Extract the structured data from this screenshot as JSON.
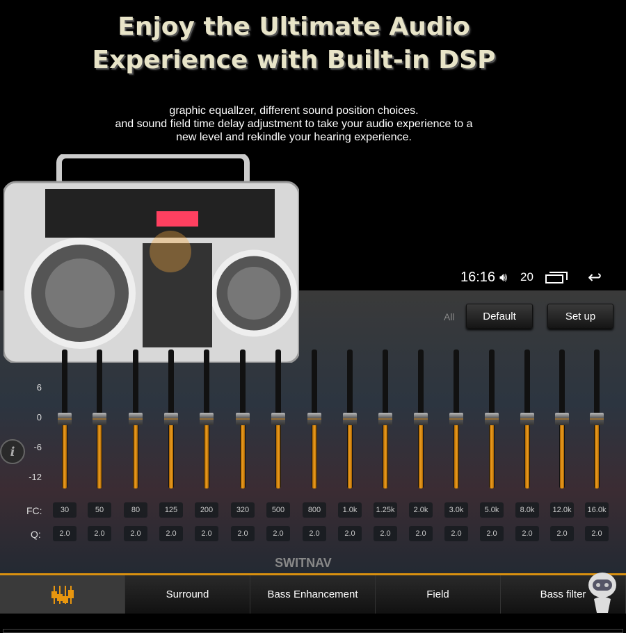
{
  "headline": [
    "Enjoy the Ultimate Audio",
    "Experience with Built-in DSP"
  ],
  "subtitle": [
    "graphic equallzer, different sound position choices.",
    "and sound field time delay adjustment to take your audio experience to a",
    "new level and rekindle your hearing experience."
  ],
  "status": {
    "time": "16:16",
    "volume": "20",
    "volume_icon": "speaker-icon",
    "recents_icon": "recent-apps-icon",
    "back_icon": "back-arrow-icon"
  },
  "controls": {
    "all_label": "All",
    "default_label": "Default",
    "setup_label": "Set up"
  },
  "eq": {
    "y_axis": [
      "6",
      "0",
      "-6",
      "-12"
    ],
    "range_db": [
      -12,
      12
    ],
    "fc_label": "FC:",
    "q_label": "Q:",
    "bands": [
      {
        "fc": "30",
        "q": "2.0",
        "gain": 0
      },
      {
        "fc": "50",
        "q": "2.0",
        "gain": 0
      },
      {
        "fc": "80",
        "q": "2.0",
        "gain": 0
      },
      {
        "fc": "125",
        "q": "2.0",
        "gain": 0
      },
      {
        "fc": "200",
        "q": "2.0",
        "gain": 0
      },
      {
        "fc": "320",
        "q": "2.0",
        "gain": 0
      },
      {
        "fc": "500",
        "q": "2.0",
        "gain": 0
      },
      {
        "fc": "800",
        "q": "2.0",
        "gain": 0
      },
      {
        "fc": "1.0k",
        "q": "2.0",
        "gain": 0
      },
      {
        "fc": "1.25k",
        "q": "2.0",
        "gain": 0
      },
      {
        "fc": "2.0k",
        "q": "2.0",
        "gain": 0
      },
      {
        "fc": "3.0k",
        "q": "2.0",
        "gain": 0
      },
      {
        "fc": "5.0k",
        "q": "2.0",
        "gain": 0
      },
      {
        "fc": "8.0k",
        "q": "2.0",
        "gain": 0
      },
      {
        "fc": "12.0k",
        "q": "2.0",
        "gain": 0
      },
      {
        "fc": "16.0k",
        "q": "2.0",
        "gain": 0
      }
    ],
    "accent": "#e8960f"
  },
  "brand": "SWITNAV",
  "tabs": [
    {
      "label": "",
      "icon": "equalizer-icon",
      "active": true
    },
    {
      "label": "Surround"
    },
    {
      "label": "Bass Enhancement"
    },
    {
      "label": "Field"
    },
    {
      "label": "Bass filter"
    }
  ]
}
